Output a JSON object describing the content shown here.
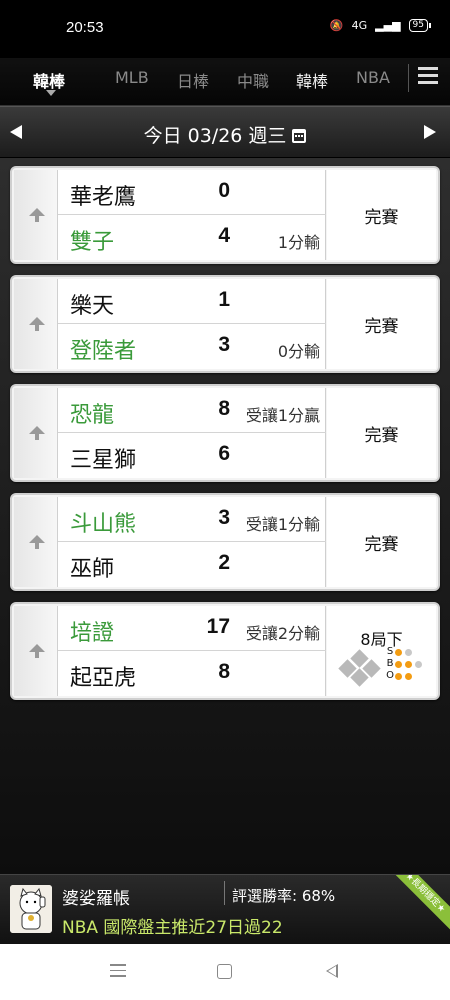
{
  "status_bar": {
    "time": "20:53",
    "network": "4G",
    "battery": "95"
  },
  "nav": {
    "tabs": [
      {
        "label": "韓棒",
        "active": true
      },
      {
        "label": "MLB"
      },
      {
        "label": "日棒"
      },
      {
        "label": "中職"
      },
      {
        "label": "韓棒"
      },
      {
        "label": "NBA"
      }
    ],
    "menu_icon": "menu-icon"
  },
  "datebar": {
    "date": "今日 03/26 週三",
    "prev_icon": "triangle-left",
    "next_icon": "triangle-right",
    "calendar_icon": "calendar-icon"
  },
  "games": [
    {
      "home": {
        "name": "華老鷹",
        "score": "0",
        "odds": "",
        "highlight": false
      },
      "away": {
        "name": "雙子",
        "score": "4",
        "odds": "1分輸",
        "highlight": true
      },
      "status": "完賽"
    },
    {
      "home": {
        "name": "樂天",
        "score": "1",
        "odds": "",
        "highlight": false
      },
      "away": {
        "name": "登陸者",
        "score": "3",
        "odds": "0分輸",
        "highlight": true
      },
      "status": "完賽"
    },
    {
      "home": {
        "name": "恐龍",
        "score": "8",
        "odds": "受讓1分贏",
        "highlight": true
      },
      "away": {
        "name": "三星獅",
        "score": "6",
        "odds": "",
        "highlight": false
      },
      "status": "完賽"
    },
    {
      "home": {
        "name": "斗山熊",
        "score": "3",
        "odds": "受讓1分輸",
        "highlight": true
      },
      "away": {
        "name": "巫師",
        "score": "2",
        "odds": "",
        "highlight": false
      },
      "status": "完賽"
    },
    {
      "home": {
        "name": "培證",
        "score": "17",
        "odds": "受讓2分輸",
        "highlight": true
      },
      "away": {
        "name": "起亞虎",
        "score": "8",
        "odds": "",
        "highlight": false
      },
      "status": "8局下",
      "live": true,
      "sbo": {
        "S": "S",
        "B": "B",
        "O": "O",
        "strikes": 1,
        "balls": 2,
        "outs": 2
      }
    }
  ],
  "colors": {
    "green": "#3a9a3a",
    "ad_text": "#c9e86a",
    "out_dot": "#f39c12"
  },
  "ad": {
    "title": "婆娑羅帳",
    "rate": "評選勝率: 68%",
    "text": "NBA 國際盤主推近27日過22",
    "ribbon": "★長期穩定★"
  },
  "system_nav": {
    "menu": "menu-lines-icon",
    "home": "home-square-icon",
    "back": "back-triangle-icon"
  }
}
